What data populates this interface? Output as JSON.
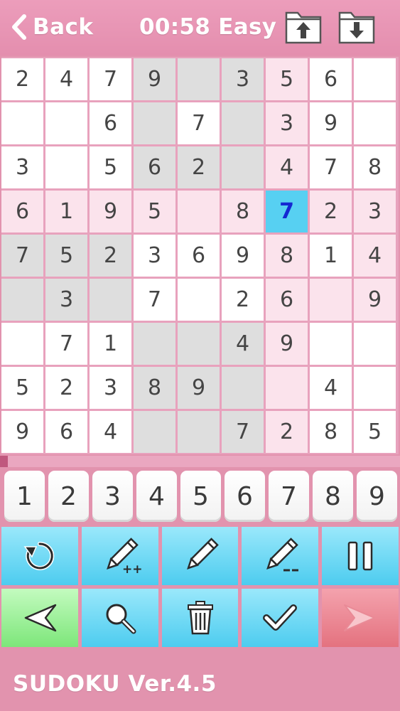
{
  "header": {
    "back_label": "Back",
    "timer_text": "00:58 Easy",
    "upload_icon": "folder-upload-icon",
    "download_icon": "folder-download-icon"
  },
  "board": {
    "cells": [
      [
        "2",
        "4",
        "7",
        "9",
        "",
        "3",
        "5",
        "6",
        ""
      ],
      [
        "",
        "",
        "6",
        "",
        "7",
        "",
        "3",
        "9",
        ""
      ],
      [
        "3",
        "",
        "5",
        "6",
        "2",
        "",
        "4",
        "7",
        "8"
      ],
      [
        "6",
        "1",
        "9",
        "5",
        "",
        "8",
        "7",
        "2",
        "3"
      ],
      [
        "7",
        "5",
        "2",
        "3",
        "6",
        "9",
        "8",
        "1",
        "4"
      ],
      [
        "",
        "3",
        "",
        "7",
        "",
        "2",
        "6",
        "",
        "9"
      ],
      [
        "",
        "7",
        "1",
        "",
        "",
        "4",
        "9",
        "",
        ""
      ],
      [
        "5",
        "2",
        "3",
        "8",
        "9",
        "",
        "",
        "4",
        ""
      ],
      [
        "9",
        "6",
        "4",
        "",
        "",
        "7",
        "2",
        "8",
        "5"
      ]
    ],
    "backgrounds": [
      [
        "w",
        "w",
        "w",
        "g",
        "g",
        "g",
        "p",
        "w",
        "w"
      ],
      [
        "w",
        "w",
        "w",
        "g",
        "w",
        "g",
        "p",
        "w",
        "w"
      ],
      [
        "w",
        "w",
        "w",
        "g",
        "g",
        "g",
        "p",
        "w",
        "w"
      ],
      [
        "p",
        "p",
        "p",
        "p",
        "p",
        "p",
        "sel",
        "p",
        "p"
      ],
      [
        "g",
        "g",
        "g",
        "w",
        "w",
        "w",
        "p",
        "w",
        "p"
      ],
      [
        "g",
        "g",
        "g",
        "w",
        "w",
        "w",
        "p",
        "p",
        "p"
      ],
      [
        "w",
        "w",
        "w",
        "g",
        "g",
        "g",
        "p",
        "w",
        "w"
      ],
      [
        "w",
        "w",
        "w",
        "g",
        "g",
        "g",
        "p",
        "w",
        "w"
      ],
      [
        "w",
        "w",
        "w",
        "g",
        "g",
        "g",
        "p",
        "w",
        "w"
      ]
    ],
    "selected": {
      "row": 4,
      "col": 7
    }
  },
  "progress": {
    "fraction": 0.02
  },
  "number_keys": [
    "1",
    "2",
    "3",
    "4",
    "5",
    "6",
    "7",
    "8",
    "9"
  ],
  "tools_row1": [
    "undo-icon",
    "pencil-plus-icon",
    "pencil-icon",
    "pencil-minus-icon",
    "pause-icon"
  ],
  "tools_row2": [
    "left-arrow-icon",
    "magnifier-icon",
    "trash-icon",
    "check-icon",
    "right-arrow-icon"
  ],
  "footer": {
    "title": "SUDOKU Ver.4.5"
  },
  "colors": {
    "background": "#e293ae",
    "selected_cell": "#57d0f2",
    "selected_digit": "#1428d2",
    "tool_blue": "#4dccef",
    "tool_green": "#7de67a",
    "tool_red": "#e4727f"
  }
}
